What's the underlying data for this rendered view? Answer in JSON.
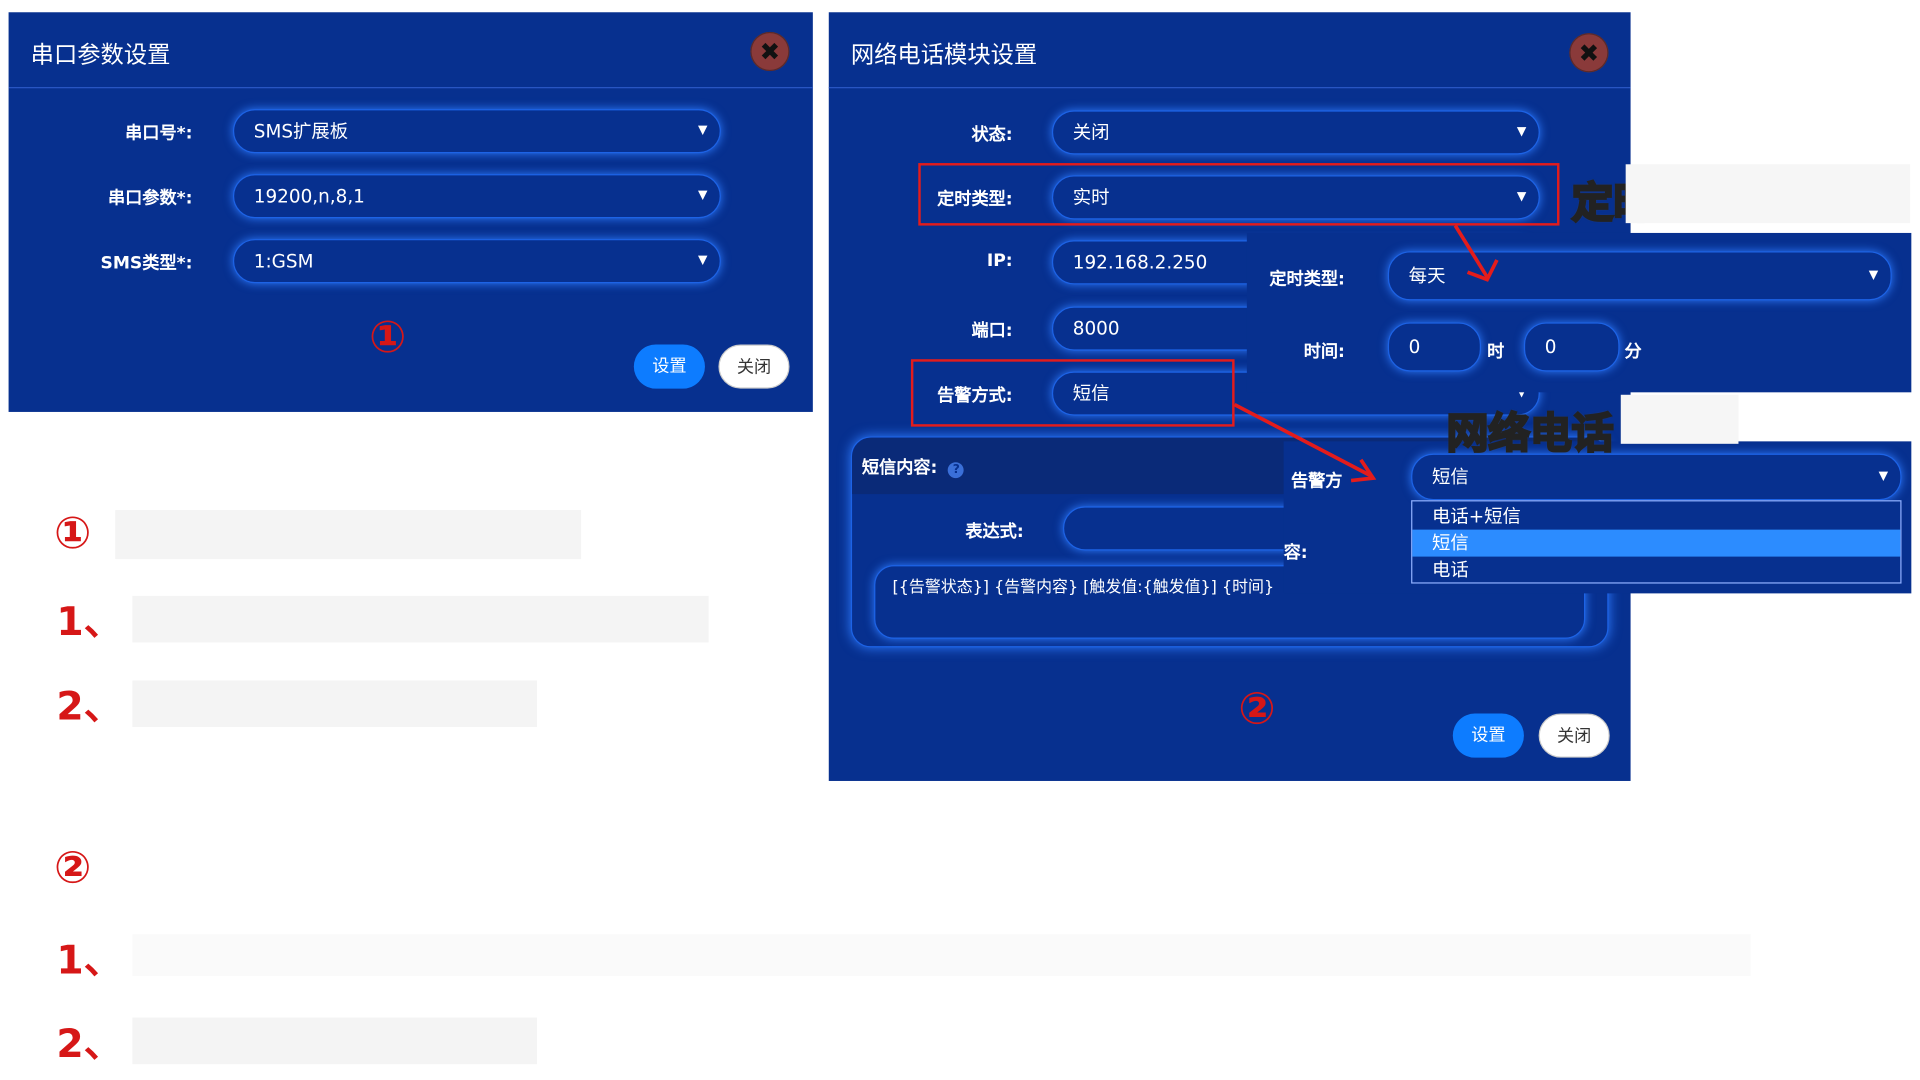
{
  "serial_dialog": {
    "title": "串口参数设置",
    "close_glyph": "✖",
    "port_label": "串口号*:",
    "port_value": "SMS扩展板",
    "params_label": "串口参数*:",
    "params_value": "19200,n,8,1",
    "sms_type_label": "SMS类型*:",
    "sms_type_value": "1:GSM",
    "marker": "①",
    "set_button": "设置",
    "close_button": "关闭"
  },
  "phone_dialog": {
    "title": "网络电话模块设置",
    "close_glyph": "✖",
    "status_label": "状态:",
    "status_value": "关闭",
    "timer_type_label": "定时类型:",
    "timer_type_value": "实时",
    "ip_label": "IP:",
    "ip_value": "192.168.2.250",
    "port_label": "端口:",
    "port_value": "8000",
    "alarm_label": "告警方式:",
    "alarm_value": "短信",
    "sms_content_label": "短信内容:",
    "help_icon": "?",
    "expr_label": "表达式:",
    "template_text": "[{告警状态}] {告警内容} [触发值:{触发值}] {时间}",
    "marker": "②",
    "set_button": "设置",
    "close_button": "关闭"
  },
  "timer_popup": {
    "caption": "定时",
    "type_label": "定时类型:",
    "type_value": "每天",
    "time_label": "时间:",
    "hour_value": "0",
    "hour_unit": "时",
    "minute_value": "0",
    "minute_unit": "分"
  },
  "phone_type_popup": {
    "caption": "网络电话",
    "alarm_label_partial": "告警方",
    "selected_value": "短信",
    "partial_label": "容:",
    "options": [
      "电话+短信",
      "短信",
      "电话"
    ],
    "highlighted_index": 1
  },
  "notes": {
    "m1": "①",
    "m1_line1_num": "1、",
    "m1_line2_num": "2、",
    "m2": "②",
    "m2_line1_num": "1、",
    "m2_line2_num": "2、"
  },
  "colors": {
    "panel_bg": "#07308f",
    "accent": "#0d7cff",
    "annotation_red": "#e31c1c",
    "highlight": "#2c8cff"
  }
}
